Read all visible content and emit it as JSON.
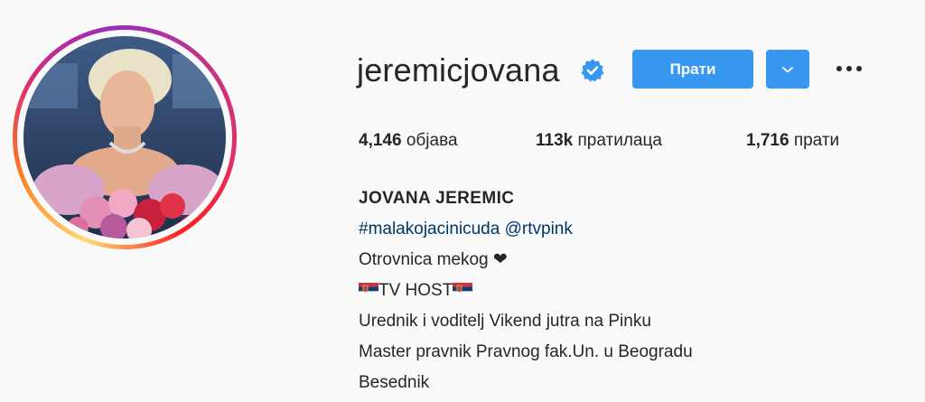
{
  "profile": {
    "username": "jeremicjovana",
    "follow_label": "Прати",
    "verified_icon": "verified-badge-icon",
    "dropdown_icon": "chevron-down-icon",
    "more_icon": "ellipsis-icon"
  },
  "stats": {
    "posts_count": "4,146",
    "posts_label": "објава",
    "followers_count": "113k",
    "followers_label": "пратилаца",
    "following_count": "1,716",
    "following_label": "прати"
  },
  "bio": {
    "full_name": "JOVANA JEREMIC",
    "hashtag": "#malakojacinicuda",
    "mention": "@rtvpink",
    "line1": "Otrovnica mekog ❤",
    "line2_text": "TV HOST",
    "line3": "Urednik i voditelj Vikend jutra na Pinku",
    "line4": "Master pravnik Pravnog fak.Un. u Beogradu",
    "line5": "Besednik"
  },
  "colors": {
    "accent": "#3897f0",
    "link": "#003569",
    "text": "#262626",
    "background": "#fafafa"
  }
}
